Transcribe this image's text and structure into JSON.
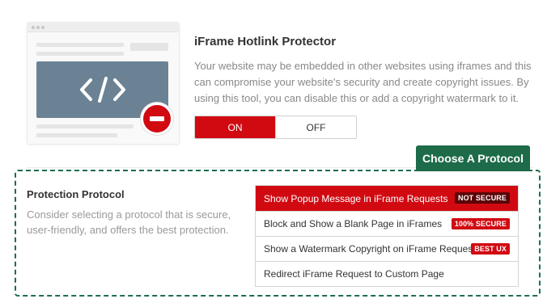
{
  "header": {
    "title": "iFrame Hotlink Protector",
    "description": "Your website may be embedded in other websites using iframes and this can compromise your website's security and create copyright issues. By using this tool, you can disable this or add a copyright watermark to it."
  },
  "toggle": {
    "on_label": "ON",
    "off_label": "OFF",
    "selected": "ON"
  },
  "choose_button": "Choose A Protocol",
  "protocol": {
    "title": "Protection Protocol",
    "description": "Consider selecting a protocol that is secure, user-friendly, and offers the best protection.",
    "options": [
      {
        "label": "Show Popup Message in iFrame Requests",
        "badge": "NOT SECURE",
        "selected": true
      },
      {
        "label": "Block and Show a Blank Page in iFrames",
        "badge": "100% SECURE",
        "selected": false
      },
      {
        "label": "Show a Watermark Copyright on iFrame Requests",
        "badge": "BEST UX",
        "selected": false
      },
      {
        "label": "Redirect iFrame Request to Custom Page",
        "badge": "",
        "selected": false
      }
    ]
  },
  "colors": {
    "accent_red": "#d10a12",
    "accent_green": "#1d6b48",
    "illustration_screen": "#6b8294"
  },
  "icons": {
    "illustration": "browser-window-icon",
    "code": "code-brackets-icon",
    "block": "no-entry-icon"
  }
}
